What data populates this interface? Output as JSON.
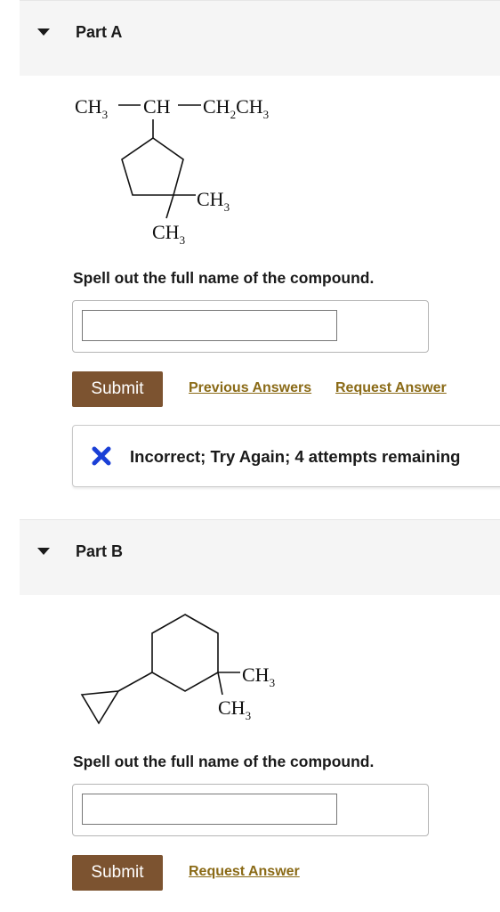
{
  "part_a": {
    "title": "Part A",
    "structure_labels": {
      "top_left": "CH",
      "top_left_sub": "3",
      "top_mid": "CH",
      "top_right_a": "CH",
      "top_right_a_sub": "2",
      "top_right_b": "CH",
      "top_right_b_sub": "3",
      "methyl_right": "CH",
      "methyl_right_sub": "3",
      "methyl_bottom": "CH",
      "methyl_bottom_sub": "3"
    },
    "prompt": "Spell out the full name of the compound.",
    "answer_value": "",
    "submit_label": "Submit",
    "previous_answers_label": "Previous Answers",
    "request_answer_label": "Request Answer",
    "feedback": {
      "icon": "x-icon",
      "icon_color": "#1a3fd6",
      "message": "Incorrect; Try Again; 4 attempts remaining"
    }
  },
  "part_b": {
    "title": "Part B",
    "structure_labels": {
      "methyl_right": "CH",
      "methyl_right_sub": "3",
      "methyl_bottom": "CH",
      "methyl_bottom_sub": "3"
    },
    "prompt": "Spell out the full name of the compound.",
    "answer_value": "",
    "submit_label": "Submit",
    "request_answer_label": "Request Answer"
  },
  "colors": {
    "submit_bg": "#7c5330",
    "link": "#8a6a16",
    "header_bg": "#f5f5f5"
  }
}
